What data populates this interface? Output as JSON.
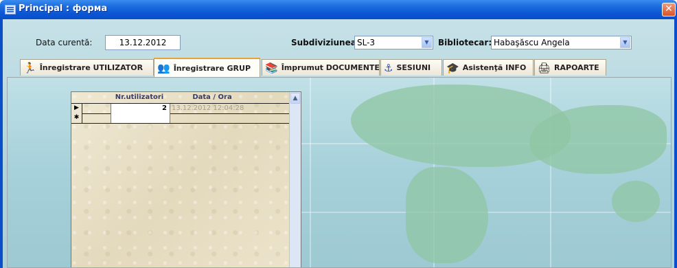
{
  "window": {
    "title": "Principal : форма",
    "close_glyph": "✕"
  },
  "header": {
    "date_label": "Data curentă:",
    "date_value": "13.12.2012",
    "subdivision_label": "Subdiviziunea:",
    "subdivision_value": "SL-3",
    "librarian_label": "Bibliotecar:",
    "librarian_value": "Habaşăscu Angela"
  },
  "tabs": [
    {
      "label": "Înregistrare UTILIZATOR",
      "icon": "running-person-icon",
      "active": false
    },
    {
      "label": "Înregistrare GRUP",
      "icon": "group-people-icon",
      "active": true
    },
    {
      "label": "Împrumut DOCUMENTE",
      "icon": "books-icon",
      "active": false
    },
    {
      "label": "SESIUNI",
      "icon": "anchor-icon",
      "active": false
    },
    {
      "label": "Asistenţă INFO",
      "icon": "assistant-icon",
      "active": false
    },
    {
      "label": "RAPOARTE",
      "icon": "printer-icon",
      "active": false
    }
  ],
  "grid": {
    "columns": [
      "Nr.utilizatori",
      "Data / Ora"
    ],
    "rows": [
      {
        "selector": "▶",
        "nr_utilizatori": "2",
        "data_ora": "13.12.2012 12:04:28"
      },
      {
        "selector": "✱",
        "nr_utilizatori": "",
        "data_ora": ""
      }
    ]
  },
  "colors": {
    "titlebar": "#0b56d4",
    "client_bg": "#b0d4dd",
    "active_tab_accent": "#e6a33a"
  }
}
